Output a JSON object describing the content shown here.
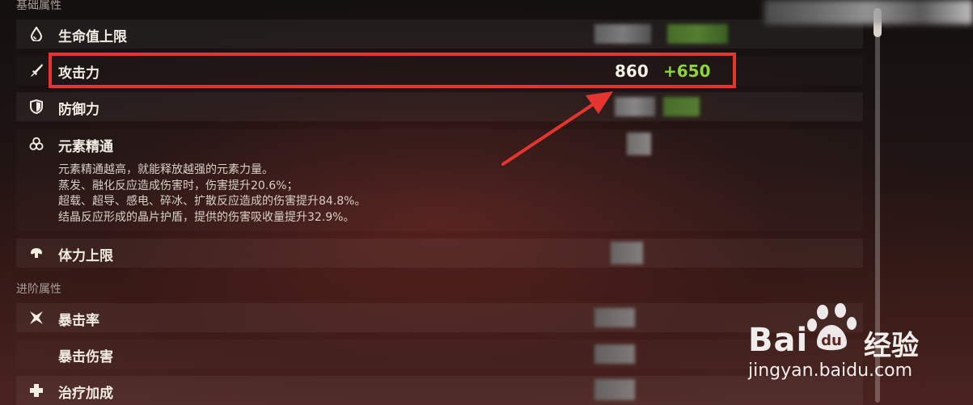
{
  "sections": {
    "basic": "基础属性",
    "advanced": "进阶属性"
  },
  "stats": {
    "hp": "生命值上限",
    "atk": "攻击力",
    "atk_base": "860",
    "atk_bonus": "+650",
    "def": "防御力",
    "em": "元素精通",
    "stamina": "体力上限",
    "crit_rate": "暴击率",
    "crit_dmg": "暴击伤害",
    "heal": "治疗加成"
  },
  "em_description": [
    "元素精通越高，就能释放越强的元素力量。",
    "蒸发、融化反应造成伤害时，伤害提升20.6%；",
    "超载、超导、感电、碎冰、扩散反应造成的伤害提升84.8%。",
    "结晶反应形成的晶片护盾，提供的伤害吸收量提升32.9%。"
  ],
  "watermark": {
    "brand_left": "Bai",
    "brand_right": "经验",
    "url": "jingyan.baidu.com"
  },
  "colors": {
    "highlight_border": "#e8342f",
    "bonus_value": "#8fd43c",
    "annotation_arrow": "#e8342f"
  }
}
